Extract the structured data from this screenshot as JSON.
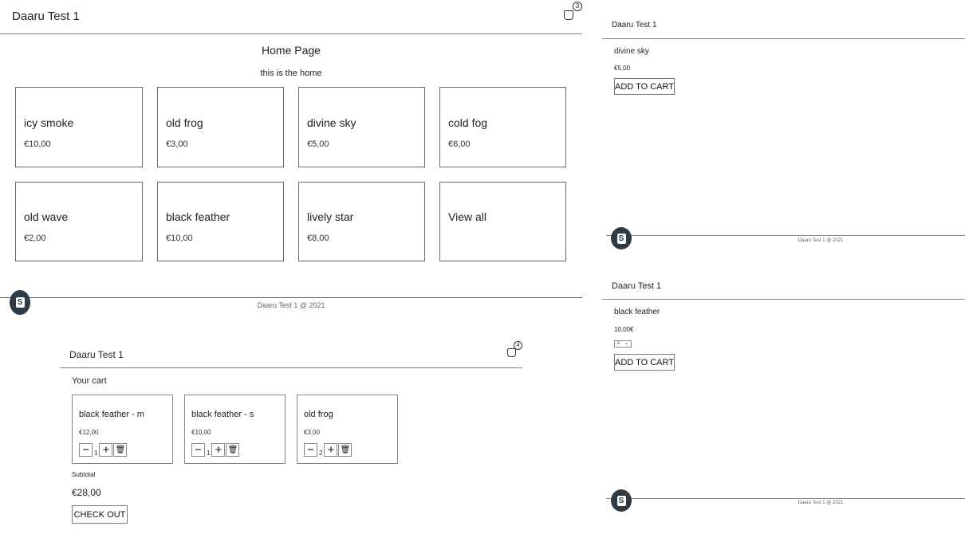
{
  "store_name": "Daaru Test 1",
  "footer_text": "Daaru Test 1 @ 2021",
  "home": {
    "cart_count": "3",
    "title": "Home Page",
    "subtitle": "this is the home",
    "products": [
      {
        "name": "icy smoke",
        "price": "€10,00"
      },
      {
        "name": "old frog",
        "price": "€3,00"
      },
      {
        "name": "divine sky",
        "price": "€5,00"
      },
      {
        "name": "cold fog",
        "price": "€6,00"
      },
      {
        "name": "old wave",
        "price": "€2,00"
      },
      {
        "name": "black feather",
        "price": "€10,00"
      },
      {
        "name": "lively star",
        "price": "€8,00"
      }
    ],
    "view_all": "View all"
  },
  "product1": {
    "name": "divine sky",
    "price": "€5,00",
    "add_to_cart": "ADD TO CART"
  },
  "product2": {
    "name": "black feather",
    "price": "10,00€",
    "size_selected": "s",
    "add_to_cart": "ADD TO CART"
  },
  "cart": {
    "cart_count": "4",
    "title": "Your cart",
    "items": [
      {
        "name": "black feather - m",
        "price": "€12,00",
        "qty": "1"
      },
      {
        "name": "black feather - s",
        "price": "€10,00",
        "qty": "1"
      },
      {
        "name": "old frog",
        "price": "€3,00",
        "qty": "2"
      }
    ],
    "subtotal_label": "Subtotal",
    "subtotal": "€28,00",
    "checkout": "CHECK OUT"
  },
  "icons": {
    "cart": "shopping-bag-icon",
    "logo": "shopify-logo",
    "minus": "minus-icon",
    "plus": "plus-icon",
    "delete": "trash-icon"
  }
}
